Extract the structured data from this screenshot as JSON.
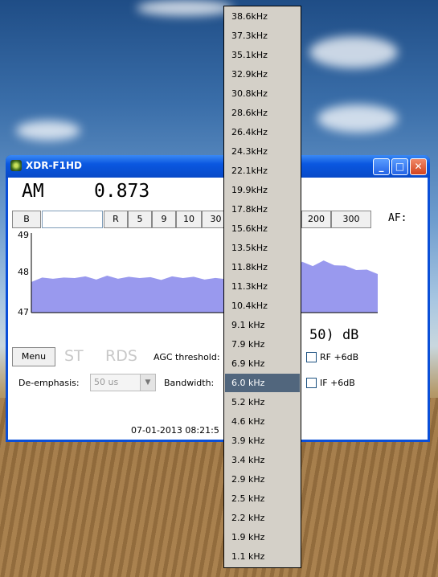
{
  "window": {
    "title": "XDR-F1HD",
    "minimize_glyph": "_",
    "maximize_glyph": "□",
    "close_glyph": "✕"
  },
  "tuner": {
    "mode": "AM",
    "frequency": "0.873",
    "freq_input_value": "",
    "buttons": [
      "B",
      "R",
      "5",
      "9",
      "10",
      "30"
    ],
    "buttons_right": [
      "200",
      "300"
    ],
    "af_label": "AF:"
  },
  "signal_chart": {
    "y_ticks": [
      "49",
      "48",
      "47"
    ],
    "fill_color": "#9999ee"
  },
  "chart_data": {
    "type": "area",
    "title": "",
    "xlabel": "",
    "ylabel": "",
    "ylim": [
      47,
      49
    ],
    "yticks": [
      49,
      48,
      47
    ],
    "series": [
      {
        "values": [
          47.8,
          47.85,
          47.88,
          47.85,
          47.9,
          47.88,
          47.86,
          47.9,
          47.88,
          47.87,
          47.9,
          47.86,
          47.85,
          47.88,
          47.9,
          47.87,
          47.86,
          47.84,
          47.87,
          47.89,
          47.86,
          47.85,
          47.88,
          47.87,
          47.86,
          48.25,
          48.2,
          48.28,
          48.22,
          48.15,
          48.1,
          48.05,
          48.0
        ]
      }
    ]
  },
  "signal_readout": "50) dB",
  "controls": {
    "menu_label": "Menu",
    "st_label": "ST",
    "rds_label": "RDS",
    "agc_label": "AGC threshold:",
    "rf_label": "RF +6dB",
    "deemphasis_label": "De-emphasis:",
    "deemphasis_value": "50 us",
    "bandwidth_label": "Bandwidth:",
    "if_label": "IF +6dB"
  },
  "status_text": "07-01-2013 08:21:5",
  "bandwidth_options": [
    "38.6kHz",
    "37.3kHz",
    "35.1kHz",
    "32.9kHz",
    "30.8kHz",
    "28.6kHz",
    "26.4kHz",
    "24.3kHz",
    "22.1kHz",
    "19.9kHz",
    "17.8kHz",
    "15.6kHz",
    "13.5kHz",
    "11.8kHz",
    "11.3kHz",
    "10.4kHz",
    "9.1 kHz",
    "7.9 kHz",
    "6.9 kHz",
    "6.0 kHz",
    "5.2 kHz",
    "4.6 kHz",
    "3.9 kHz",
    "3.4 kHz",
    "2.9 kHz",
    "2.5 kHz",
    "2.2 kHz",
    "1.9 kHz",
    "1.1 kHz"
  ],
  "selected_bandwidth": "6.0 kHz"
}
